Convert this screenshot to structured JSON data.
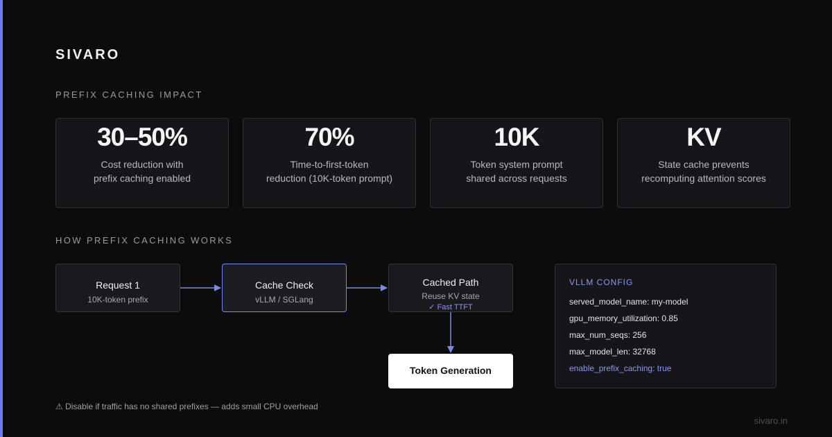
{
  "brand": "SIVARO",
  "impact_label": "PREFIX CACHING IMPACT",
  "stats": [
    {
      "value": "30–50%",
      "desc": "Cost reduction with\nprefix caching enabled"
    },
    {
      "value": "70%",
      "desc": "Time-to-first-token\nreduction (10K-token prompt)"
    },
    {
      "value": "10K",
      "desc": "Token system prompt\nshared across requests"
    },
    {
      "value": "KV",
      "desc": "State cache prevents\nrecomputing attention scores"
    }
  ],
  "works_label": "HOW PREFIX CACHING WORKS",
  "flow": {
    "request": {
      "title": "Request 1",
      "sub": "10K-token prefix"
    },
    "cache_check": {
      "title": "Cache Check",
      "sub": "vLLM / SGLang"
    },
    "cached_path": {
      "title": "Cached Path",
      "sub": "Reuse KV state",
      "note": "✓ Fast TTFT"
    },
    "token_generation": {
      "title": "Token Generation"
    }
  },
  "config": {
    "title": "VLLM CONFIG",
    "lines": [
      "served_model_name: my-model",
      "gpu_memory_utilization: 0.85",
      "max_num_seqs: 256",
      "max_model_len: 32768",
      "enable_prefix_caching: true"
    ]
  },
  "footer_note": "⚠ Disable if traffic has no shared prefixes — adds small CPU overhead",
  "site": "sivaro.in",
  "colors": {
    "accent": "#6f7cf0",
    "background": "#0c0c0d",
    "card": "#16161a"
  }
}
